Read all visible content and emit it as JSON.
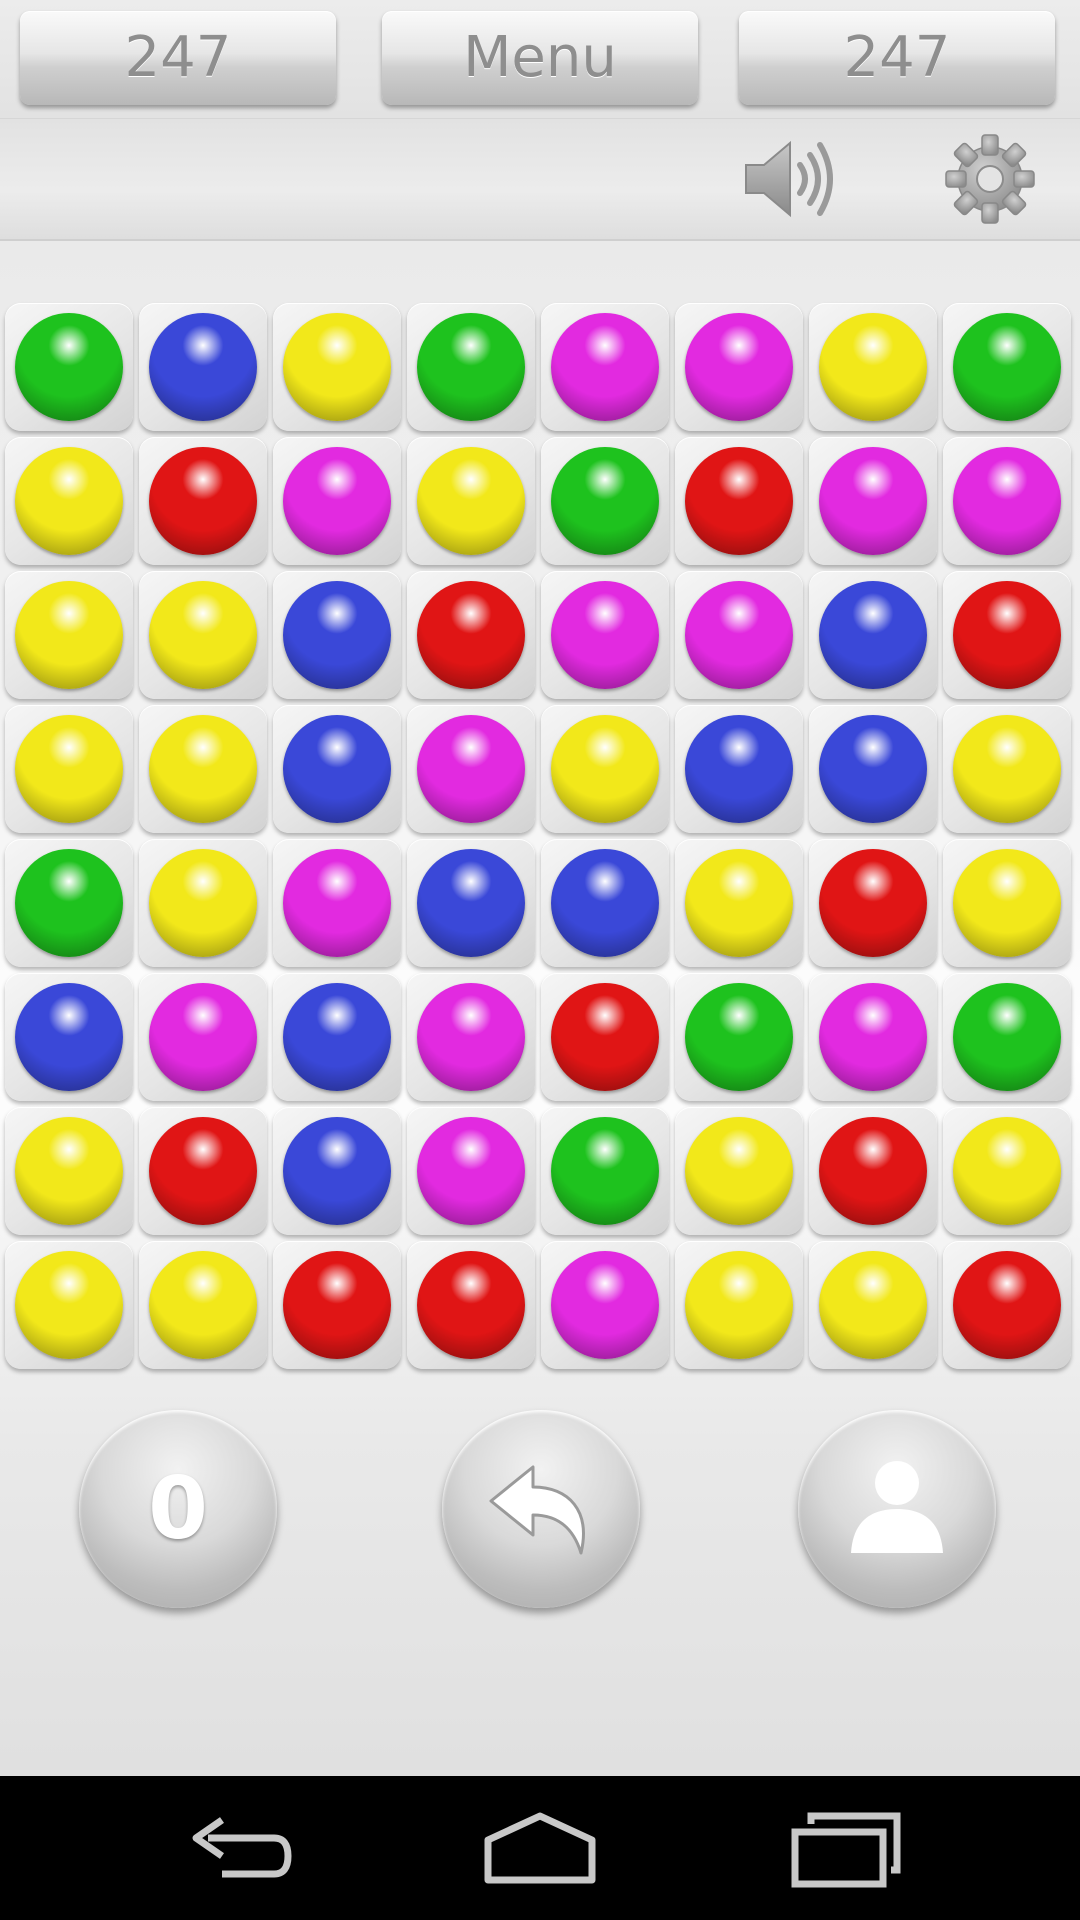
{
  "topbar": {
    "left_score": "247",
    "menu_label": "Menu",
    "right_score": "247"
  },
  "toolbar": {
    "sound_icon": "speaker-icon",
    "settings_icon": "gear-icon"
  },
  "board": {
    "rows": 8,
    "cols": 8,
    "grid": [
      [
        "green",
        "blue",
        "yellow",
        "green",
        "magenta",
        "magenta",
        "yellow",
        "green"
      ],
      [
        "yellow",
        "red",
        "magenta",
        "yellow",
        "green",
        "red",
        "magenta",
        "magenta"
      ],
      [
        "yellow",
        "yellow",
        "blue",
        "red",
        "magenta",
        "magenta",
        "blue",
        "red"
      ],
      [
        "yellow",
        "yellow",
        "blue",
        "magenta",
        "yellow",
        "blue",
        "blue",
        "yellow"
      ],
      [
        "green",
        "yellow",
        "magenta",
        "blue",
        "blue",
        "yellow",
        "red",
        "yellow"
      ],
      [
        "blue",
        "magenta",
        "blue",
        "magenta",
        "red",
        "green",
        "magenta",
        "green"
      ],
      [
        "yellow",
        "red",
        "blue",
        "magenta",
        "green",
        "yellow",
        "red",
        "yellow"
      ],
      [
        "yellow",
        "yellow",
        "red",
        "red",
        "magenta",
        "yellow",
        "yellow",
        "red"
      ]
    ]
  },
  "colors": {
    "green": "#1ec21e",
    "blue": "#3a48d8",
    "yellow": "#f2e81a",
    "magenta": "#e22ae0",
    "red": "#e01515"
  },
  "controls": {
    "score_value": "0",
    "undo_icon": "undo-arrow-icon",
    "user_icon": "user-icon"
  },
  "navbar": {
    "back_icon": "back-icon",
    "home_icon": "home-icon",
    "recents_icon": "recents-icon"
  }
}
